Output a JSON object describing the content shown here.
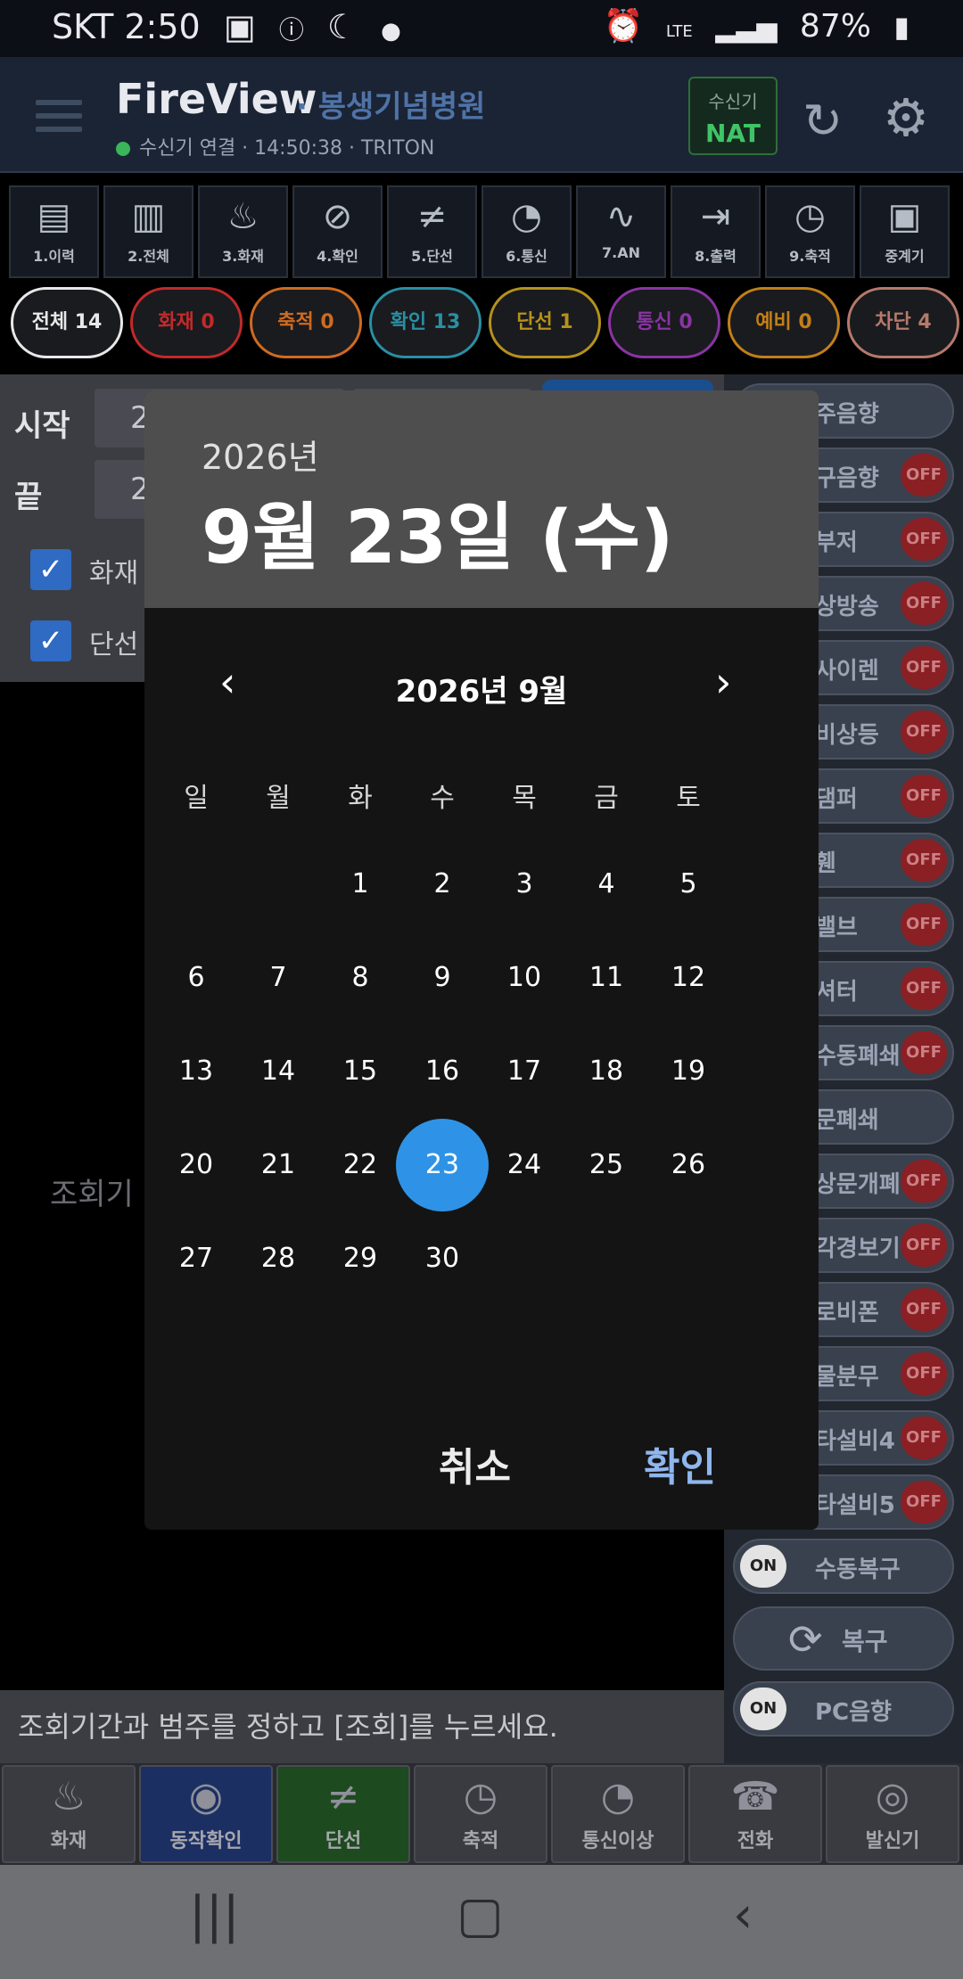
{
  "status_bar": {
    "carrier_time": "SKT 2:50",
    "signal": "LTE",
    "battery": "87%"
  },
  "header": {
    "app_title": "FireView",
    "hospital": "· 봉생기념병원",
    "connection": "수신기 연결 · 14:50:38 · TRITON",
    "receiver_label": "수신기",
    "receiver_value": "NAT"
  },
  "toolbar": [
    {
      "label": "1.이력",
      "icon": "document-icon"
    },
    {
      "label": "2.전체",
      "icon": "documents-icon"
    },
    {
      "label": "3.화재",
      "icon": "fire-icon"
    },
    {
      "label": "4.확인",
      "icon": "search-check-icon"
    },
    {
      "label": "5.단선",
      "icon": "broken-line-icon"
    },
    {
      "label": "6.통신",
      "icon": "satellite-icon"
    },
    {
      "label": "7.AN",
      "icon": "wave-icon"
    },
    {
      "label": "8.출력",
      "icon": "exit-icon"
    },
    {
      "label": "9.축적",
      "icon": "clock-icon"
    },
    {
      "label": "중계기",
      "icon": "relay-icon"
    }
  ],
  "chips": [
    {
      "label": "전체 14",
      "color": "#e8e8e8"
    },
    {
      "label": "화재 0",
      "color": "#c22a2a"
    },
    {
      "label": "축적 0",
      "color": "#cf6b20"
    },
    {
      "label": "확인 13",
      "color": "#2a8fa3"
    },
    {
      "label": "단선 1",
      "color": "#b5921c"
    },
    {
      "label": "통신 0",
      "color": "#8a34a3"
    },
    {
      "label": "예비 0",
      "color": "#c27f18"
    },
    {
      "label": "차단 4",
      "color": "#b57a6a"
    }
  ],
  "search": {
    "start_label": "시작",
    "end_label": "끝",
    "start_value": "2",
    "end_value": "2",
    "check1_label": "화재",
    "check2_label": "단선",
    "hint": "조회기"
  },
  "right_controls": [
    {
      "label": "주음향",
      "state": ""
    },
    {
      "label": "구음향",
      "state": "OFF"
    },
    {
      "label": "부저",
      "state": "OFF"
    },
    {
      "label": "상방송",
      "state": "OFF"
    },
    {
      "label": "사이렌",
      "state": "OFF"
    },
    {
      "label": "비상등",
      "state": "OFF"
    },
    {
      "label": "댐퍼",
      "state": "OFF"
    },
    {
      "label": "휀",
      "state": "OFF"
    },
    {
      "label": "밸브",
      "state": "OFF"
    },
    {
      "label": "셔터",
      "state": "OFF"
    },
    {
      "label": "수동폐쇄",
      "state": "OFF"
    },
    {
      "label": "문폐쇄",
      "state": ""
    },
    {
      "label": "상문개폐",
      "state": "OFF"
    },
    {
      "label": "각경보기",
      "state": "OFF"
    },
    {
      "label": "로비폰",
      "state": "OFF"
    },
    {
      "label": "물분무",
      "state": "OFF"
    },
    {
      "label": "타설비4",
      "state": "OFF"
    },
    {
      "label": "타설비5",
      "state": "OFF"
    },
    {
      "label": "수동복구",
      "state": "ON"
    }
  ],
  "restore_label": "복구",
  "pc_sound": {
    "label": "PC음향",
    "state": "ON"
  },
  "bottom_message": "조회기간과 범주를 정하고 [조회]를 누르세요.",
  "bottom_nav": [
    {
      "label": "화재",
      "icon": "fire-icon",
      "bg": "#3a3b40"
    },
    {
      "label": "동작확인",
      "icon": "eye-icon",
      "bg": "#1c2f63"
    },
    {
      "label": "단선",
      "icon": "broken-line-icon",
      "bg": "#1d4a1f"
    },
    {
      "label": "축적",
      "icon": "clock-icon",
      "bg": "#3a3b40"
    },
    {
      "label": "통신이상",
      "icon": "satellite-icon",
      "bg": "#3a3b40"
    },
    {
      "label": "전화",
      "icon": "phone-icon",
      "bg": "#3a3b40"
    },
    {
      "label": "발신기",
      "icon": "alarm-bell-icon",
      "bg": "#3a3b40"
    }
  ],
  "dialog": {
    "year": "2026년",
    "selected_date": "9월 23일 (수)",
    "month_title": "2026년 9월",
    "weekdays": [
      "일",
      "월",
      "화",
      "수",
      "목",
      "금",
      "토"
    ],
    "first_weekday_index": 2,
    "days_in_month": 30,
    "selected_day": 23,
    "accent": "#2e93e6",
    "cancel": "취소",
    "ok": "확인"
  }
}
